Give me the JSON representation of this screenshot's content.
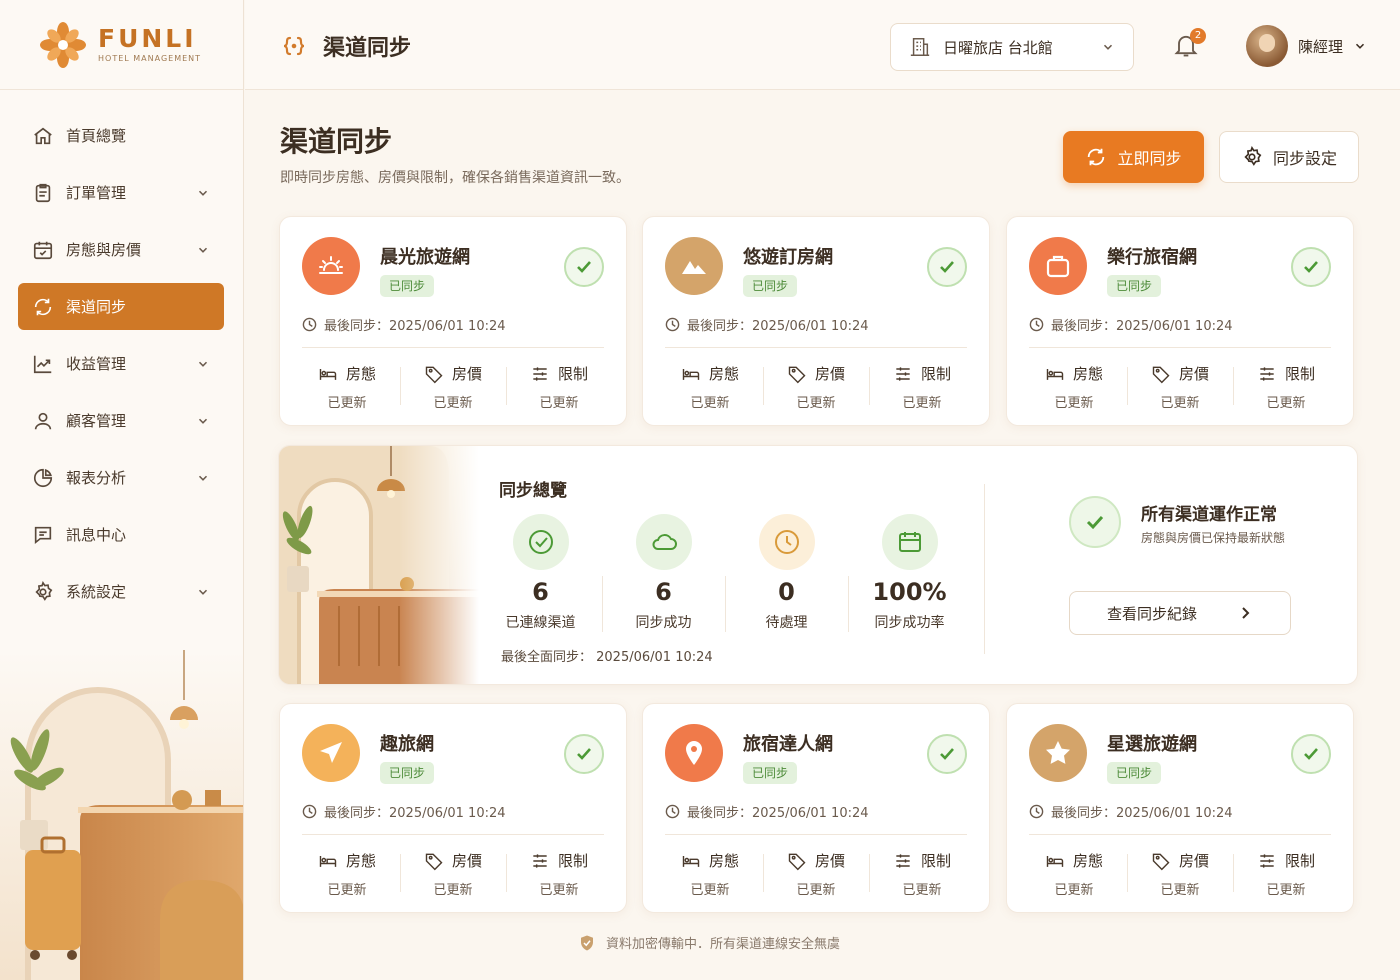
{
  "app": {
    "brand": "FUNLI",
    "brand_sub": "HOTEL MANAGEMENT"
  },
  "header": {
    "title": "渠道同步",
    "property": "日曜旅店 台北館",
    "notifications": "2",
    "user_name": "陳經理"
  },
  "sidebar": {
    "items": [
      {
        "label": "首頁總覽",
        "icon": "home-icon"
      },
      {
        "label": "訂單管理",
        "icon": "clipboard-icon",
        "expandable": true
      },
      {
        "label": "房態與房價",
        "icon": "calendar-check-icon",
        "expandable": true
      },
      {
        "label": "渠道同步",
        "icon": "sync-icon",
        "active": true
      },
      {
        "label": "收益管理",
        "icon": "trend-chart-icon",
        "expandable": true
      },
      {
        "label": "顧客管理",
        "icon": "user-icon",
        "expandable": true
      },
      {
        "label": "報表分析",
        "icon": "pie-chart-icon",
        "expandable": true
      },
      {
        "label": "訊息中心",
        "icon": "message-icon"
      },
      {
        "label": "系統設定",
        "icon": "gear-icon",
        "expandable": true
      }
    ]
  },
  "page": {
    "title": "渠道同步",
    "subtitle": "即時同步房態、房價與限制，確保各銷售渠道資訊一致。",
    "sync_now": "立即同步",
    "sync_settings": "同步設定"
  },
  "stat_labels": {
    "availability": "房態",
    "rates": "房價",
    "restrictions": "限制"
  },
  "channels": [
    {
      "name": "晨光旅遊網",
      "status": "已同步",
      "last_sync": "最後同步：2025/06/01 10:24",
      "availability": "已更新",
      "rates": "已更新",
      "restrictions": "已更新",
      "icon": "sunrise-icon",
      "color": "#f07a4a"
    },
    {
      "name": "悠遊訂房網",
      "status": "已同步",
      "last_sync": "最後同步：2025/06/01 10:24",
      "availability": "已更新",
      "rates": "已更新",
      "restrictions": "已更新",
      "icon": "mountain-icon",
      "color": "#d4a46a"
    },
    {
      "name": "樂行旅宿網",
      "status": "已同步",
      "last_sync": "最後同步：2025/06/01 10:24",
      "availability": "已更新",
      "rates": "已更新",
      "restrictions": "已更新",
      "icon": "suitcase-icon",
      "color": "#f07a4a"
    },
    {
      "name": "趣旅網",
      "status": "已同步",
      "last_sync": "最後同步：2025/06/01 10:24",
      "availability": "已更新",
      "rates": "已更新",
      "restrictions": "已更新",
      "icon": "paper-plane-icon",
      "color": "#f4b25a"
    },
    {
      "name": "旅宿達人網",
      "status": "已同步",
      "last_sync": "最後同步：2025/06/01 10:24",
      "availability": "已更新",
      "rates": "已更新",
      "restrictions": "已更新",
      "icon": "map-pin-icon",
      "color": "#f07a4a"
    },
    {
      "name": "星選旅遊網",
      "status": "已同步",
      "last_sync": "最後同步：2025/06/01 10:24",
      "availability": "已更新",
      "rates": "已更新",
      "restrictions": "已更新",
      "icon": "star-icon",
      "color": "#d4a46a"
    }
  ],
  "overview": {
    "title": "同步總覽",
    "stats": [
      {
        "value": "6",
        "label": "已連線渠道",
        "icon": "check-circle-icon"
      },
      {
        "value": "6",
        "label": "同步成功",
        "icon": "cloud-icon"
      },
      {
        "value": "0",
        "label": "待處理",
        "icon": "clock-icon"
      },
      {
        "value": "100%",
        "label": "同步成功率",
        "icon": "calendar-icon"
      }
    ],
    "last_full_sync": "最後全面同步： 2025/06/01 10:24",
    "status_title": "所有渠道運作正常",
    "status_sub": "房態與房價已保持最新狀態",
    "view_log": "查看同步紀錄"
  },
  "footer": {
    "text": "資料加密傳輸中．所有渠道連線安全無虞"
  }
}
